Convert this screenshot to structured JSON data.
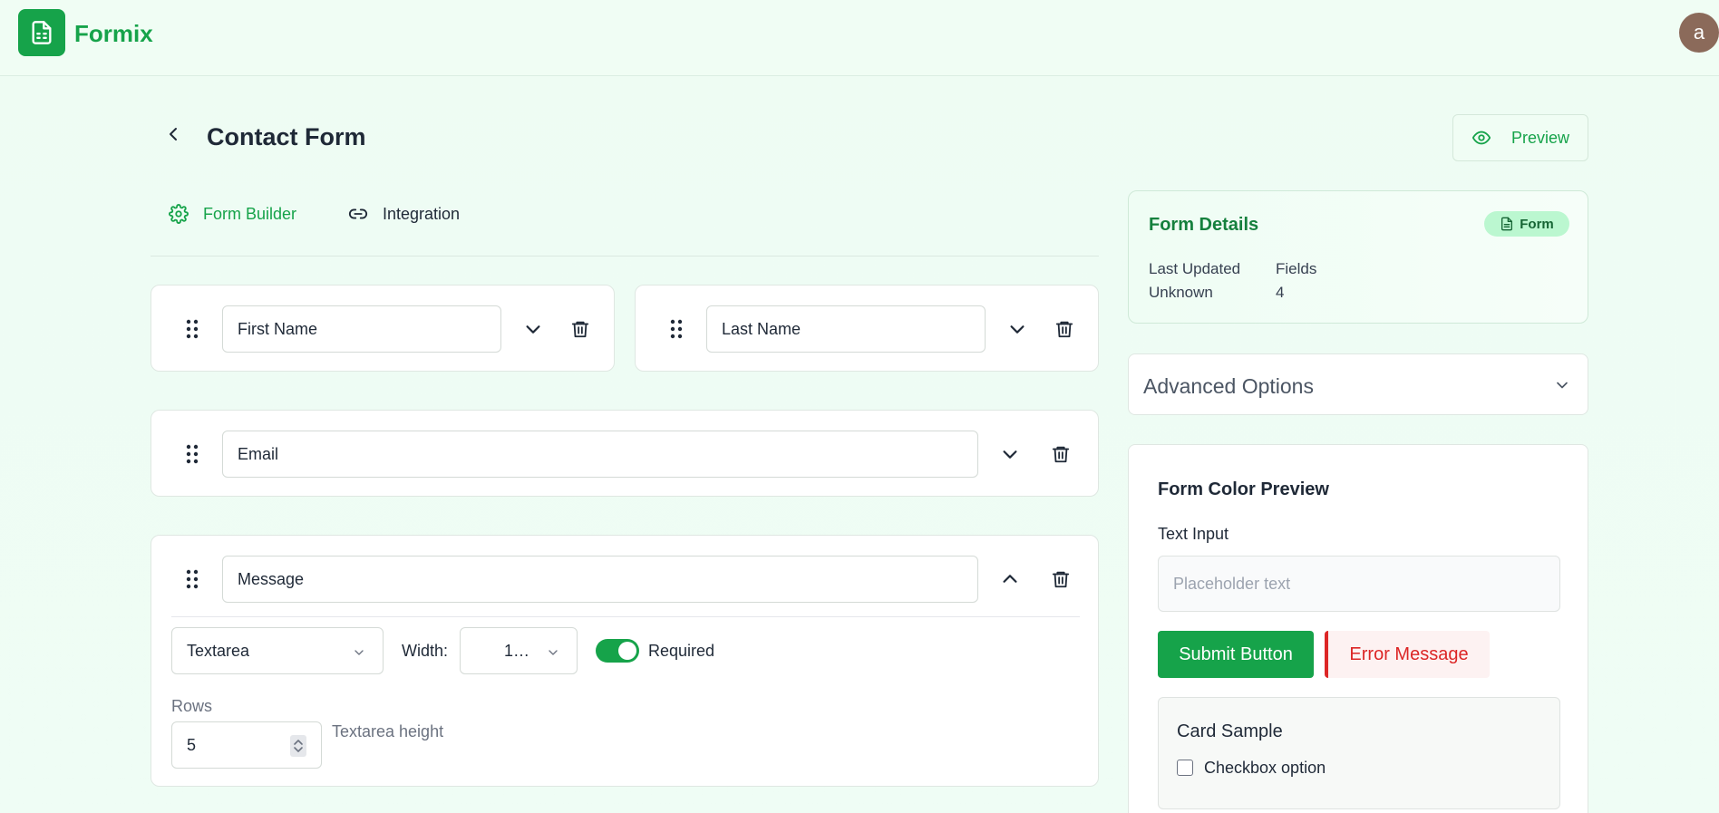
{
  "app": {
    "name": "Formix",
    "avatar_initial": "a"
  },
  "page": {
    "title": "Contact Form",
    "preview_label": "Preview"
  },
  "tabs": [
    {
      "label": "Form Builder",
      "icon": "gear-icon",
      "active": true
    },
    {
      "label": "Integration",
      "icon": "link-icon",
      "active": false
    }
  ],
  "fields": [
    {
      "value": "First Name",
      "expanded": false
    },
    {
      "value": "Last Name",
      "expanded": false
    },
    {
      "value": "Email",
      "expanded": false
    },
    {
      "value": "Message",
      "expanded": true
    }
  ],
  "message_options": {
    "type": "Textarea",
    "width_label": "Width:",
    "width_value": "1…",
    "required_label": "Required",
    "required": true,
    "rows_label": "Rows",
    "rows_value": "5",
    "rows_hint": "Textarea height"
  },
  "details": {
    "title": "Form Details",
    "badge": "Form",
    "last_updated_label": "Last Updated",
    "last_updated_value": "Unknown",
    "fields_label": "Fields",
    "fields_value": "4"
  },
  "advanced": {
    "title": "Advanced Options"
  },
  "color_preview": {
    "title": "Form Color Preview",
    "text_input_label": "Text Input",
    "placeholder": "Placeholder text",
    "submit_label": "Submit Button",
    "error_label": "Error Message",
    "card_title": "Card Sample",
    "checkbox_label": "Checkbox option"
  },
  "colors": {
    "accent": "#16a34a",
    "error": "#dc2626",
    "background": "#effdf5"
  }
}
